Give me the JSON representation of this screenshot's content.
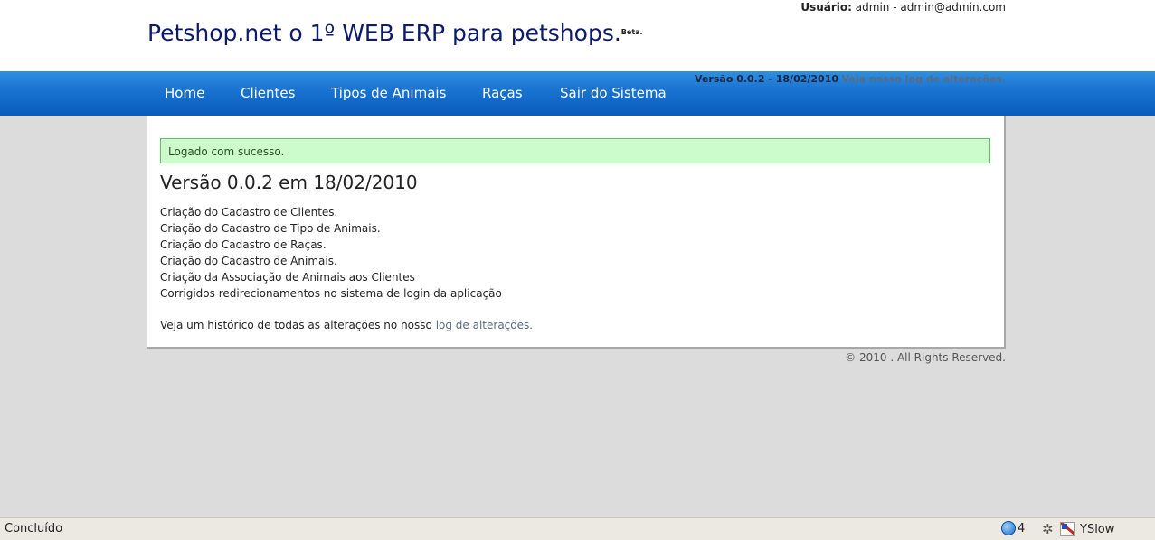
{
  "header": {
    "user_label": "Usuário:",
    "user_value": "admin - admin@admin.com",
    "title": "Petshop.net o 1º WEB ERP para petshops.",
    "title_badge": "Beta."
  },
  "nav": {
    "items": [
      {
        "label": "Home"
      },
      {
        "label": "Clientes"
      },
      {
        "label": "Tipos de Animais"
      },
      {
        "label": "Raças"
      },
      {
        "label": "Sair do Sistema"
      }
    ],
    "version_text": "Versão 0.0.2 - 18/02/2010",
    "version_link": "Veja nosso log de alterações."
  },
  "main": {
    "flash": "Logado com sucesso.",
    "heading": "Versão 0.0.2 em 18/02/2010",
    "changes": [
      "Criação do Cadastro de Clientes.",
      "Criação do Cadastro de Tipo de Animais.",
      "Criação do Cadastro de Raças.",
      "Criação do Cadastro de Animais.",
      "Criação da Associação de Animais aos Clientes",
      "Corrigidos redirecionamentos no sistema de login da aplicação"
    ],
    "history_text": "Veja um histórico de todas as alterações no nosso",
    "history_link": "log de alterações."
  },
  "footer": {
    "copyright": "© 2010 . All Rights Reserved."
  },
  "statusbar": {
    "status": "Concluído",
    "count": "4",
    "yslow_label": "YSlow"
  },
  "colors": {
    "title": "#0c1a6c",
    "nav_bg": "#1a74d2",
    "flash_bg": "#ccfbcc",
    "page_bg": "#dcdcdc"
  }
}
